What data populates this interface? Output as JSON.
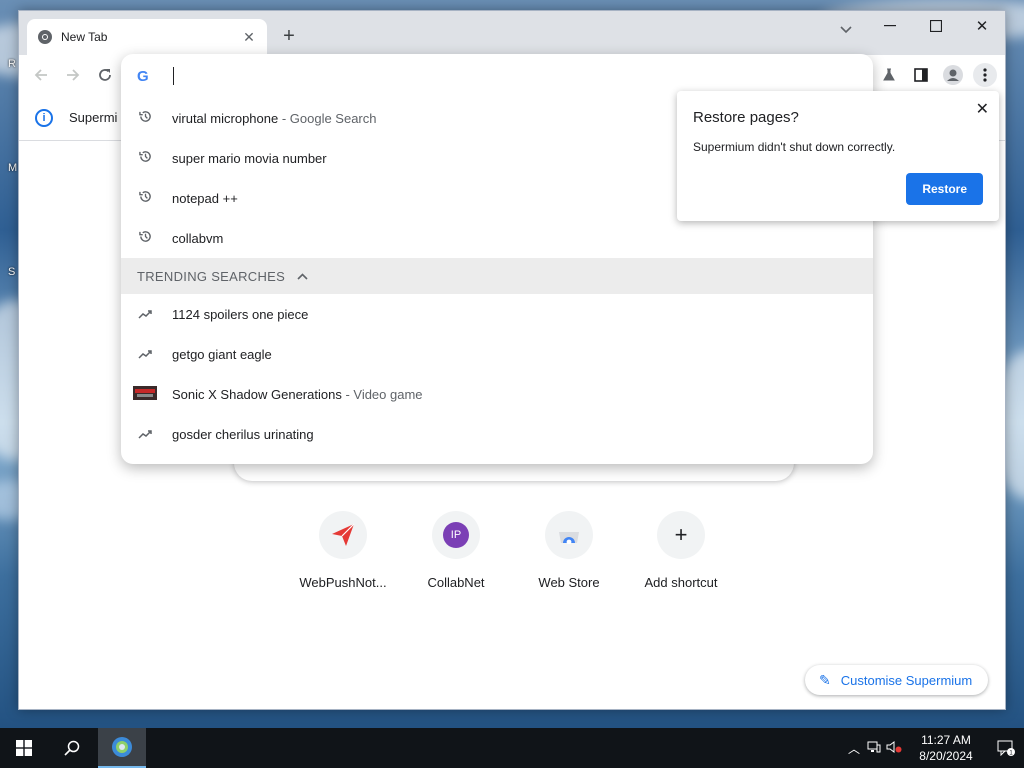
{
  "browser": {
    "tab_title": "New Tab",
    "infobar_text": "Supermi"
  },
  "omnibox": {
    "input_value": "",
    "suggestions": [
      {
        "text": "virutal microphone",
        "desc": " - Google Search",
        "icon": "history-icon"
      },
      {
        "text": "super mario movia number",
        "desc": "",
        "icon": "history-icon"
      },
      {
        "text": "notepad ++",
        "desc": "",
        "icon": "history-icon"
      },
      {
        "text": "collabvm",
        "desc": "",
        "icon": "history-icon"
      }
    ],
    "trending_header": "TRENDING SEARCHES",
    "trending": [
      {
        "text": "1124 spoilers one piece",
        "desc": "",
        "icon": "trending-icon"
      },
      {
        "text": "getgo giant eagle",
        "desc": "",
        "icon": "trending-icon"
      },
      {
        "text": "Sonic X Shadow Generations",
        "desc": " - Video game",
        "icon": "game-thumbnail"
      },
      {
        "text": "gosder cherilus urinating",
        "desc": "",
        "icon": "trending-icon"
      }
    ]
  },
  "restore_popup": {
    "title": "Restore pages?",
    "message": "Supermium didn't shut down correctly.",
    "button": "Restore"
  },
  "shortcuts": [
    {
      "label": "WebPushNot...",
      "icon": "paper-plane-icon",
      "color": "#e53935"
    },
    {
      "label": "CollabNet",
      "icon": "ip-badge",
      "initials": "IP",
      "color": "#7b3fb5"
    },
    {
      "label": "Web Store",
      "icon": "web-store-icon",
      "color": "#4285f4"
    },
    {
      "label": "Add shortcut",
      "icon": "plus-icon",
      "color": "#202124"
    }
  ],
  "customise_label": "Customise Supermium",
  "taskbar": {
    "time": "11:27 AM",
    "date": "8/20/2024",
    "notification_count": "1"
  },
  "desktop_fragments": [
    "R",
    "M",
    "S"
  ],
  "colors": {
    "accent": "#1a73e8",
    "taskbar": "#101418"
  }
}
